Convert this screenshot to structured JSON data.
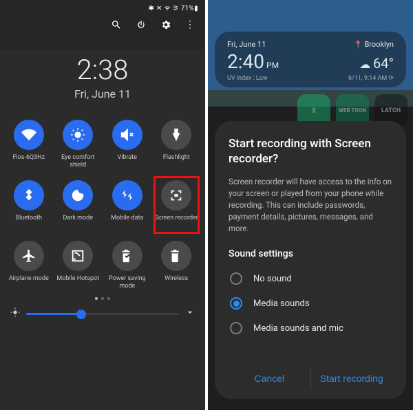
{
  "left": {
    "status": {
      "icons": "✱ ✕ ᯤ ⚞ 71%▮"
    },
    "clock": {
      "time": "2:38",
      "date": "Fri, June 11"
    },
    "tiles": [
      {
        "label": "Fios-6Q3Hz",
        "active": true
      },
      {
        "label": "Eye comfort shield",
        "active": true
      },
      {
        "label": "Vibrate",
        "active": true
      },
      {
        "label": "Flashlight",
        "active": false
      },
      {
        "label": "Bluetooth",
        "active": true
      },
      {
        "label": "Dark mode",
        "active": true
      },
      {
        "label": "Mobile data",
        "active": true
      },
      {
        "label": "Screen recorder",
        "active": false,
        "highlight": true
      },
      {
        "label": "Airplane mode",
        "active": false
      },
      {
        "label": "Mobile Hotspot",
        "active": false
      },
      {
        "label": "Power saving mode",
        "active": false
      },
      {
        "label": "Wireless",
        "active": false
      }
    ],
    "brightness": {
      "pct": 36
    }
  },
  "right": {
    "notif": {
      "date": "Fri, June 11",
      "location": "Brooklyn",
      "time": "2:40",
      "ampm": "PM",
      "temp": "64°",
      "weather_icon": "☁",
      "uv": "UV index : Low",
      "updated": "6/11, 9:14 AM ⟳"
    },
    "apps": [
      {
        "t": "X"
      },
      {
        "t": "WEB TOON"
      },
      {
        "t": "LATCH"
      }
    ],
    "dialog": {
      "title": "Start recording with Screen recorder?",
      "body": "Screen recorder will have access to the info on your screen or played from your phone while recording. This can include passwords, payment details, pictures, messages, and more.",
      "sound_title": "Sound settings",
      "options": [
        {
          "label": "No sound",
          "selected": false
        },
        {
          "label": "Media sounds",
          "selected": true
        },
        {
          "label": "Media sounds and mic",
          "selected": false
        }
      ],
      "cancel": "Cancel",
      "start": "Start recording"
    }
  }
}
